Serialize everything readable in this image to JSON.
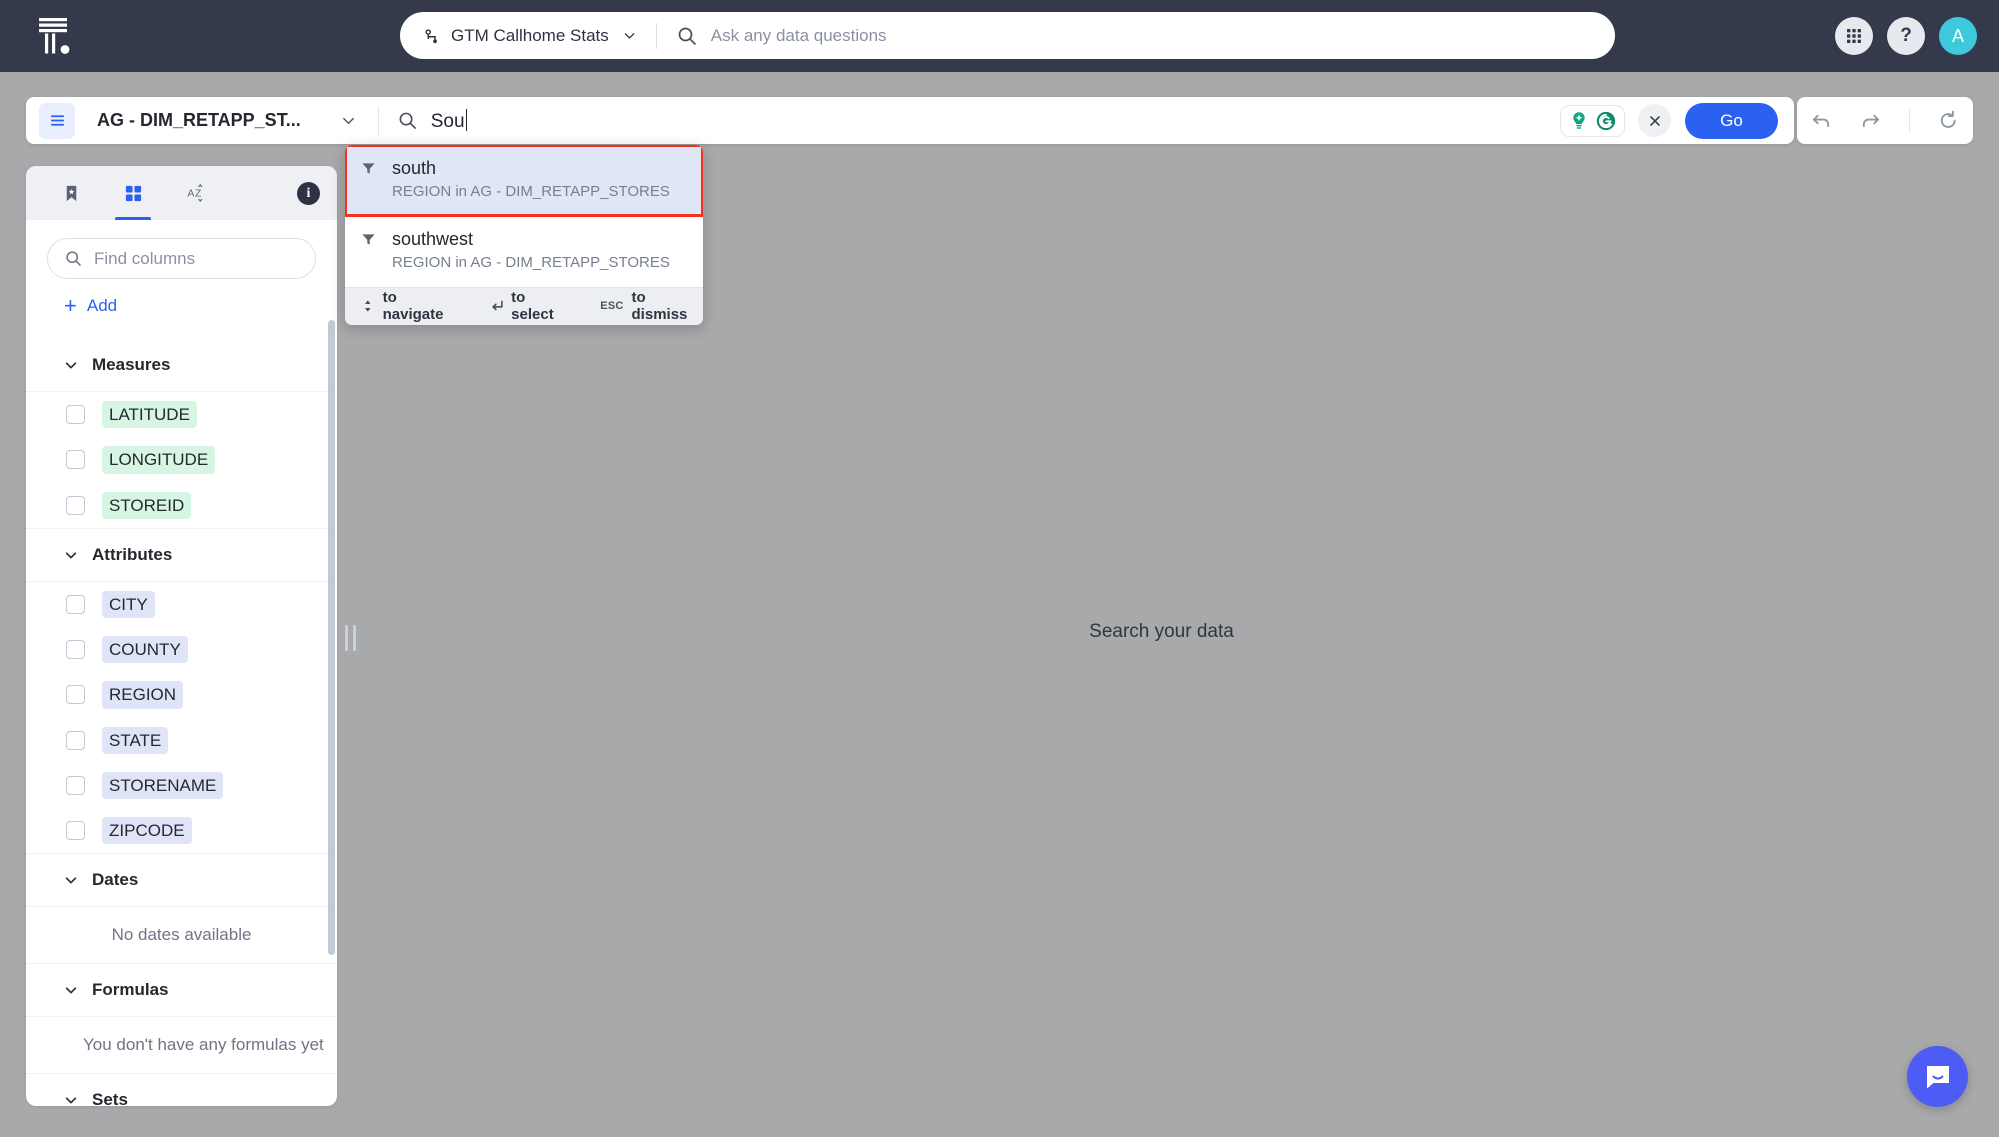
{
  "topnav": {
    "logo_name": "thoughtspot-logo",
    "datasource": {
      "icon": "datasource-icon",
      "label": "GTM Callhome Stats",
      "chevron": "chevron-down-icon"
    },
    "search": {
      "icon": "search-icon",
      "placeholder": "Ask any data questions",
      "value": ""
    },
    "apps_icon": "apps-grid-icon",
    "help_label": "?",
    "avatar_initial": "A"
  },
  "searchbar": {
    "menu_icon": "hamburger-menu-icon",
    "worksheet_name": "AG - DIM_RETAPP_ST...",
    "worksheet_chevron": "chevron-down-icon",
    "search_icon": "search-icon",
    "query_value": "Sou",
    "grammarly_assistant_icon": "grammarly-lightbulb-icon",
    "grammarly_icon": "grammarly-logo-icon",
    "clear_icon": "close-icon",
    "go_label": "Go"
  },
  "history": {
    "undo_icon": "undo-arrow-icon",
    "redo_icon": "redo-arrow-icon",
    "reset_icon": "reset-circular-arrow-icon"
  },
  "leftpanel": {
    "tabs": [
      {
        "id": "bookmarks",
        "icon": "bookmark-icon",
        "active": false
      },
      {
        "id": "columns",
        "icon": "grid-squares-icon",
        "active": true
      },
      {
        "id": "sort",
        "icon": "sort-az-icon",
        "active": false
      }
    ],
    "info_label": "i",
    "find": {
      "icon": "search-icon",
      "placeholder": "Find columns",
      "value": ""
    },
    "add_label": "Add",
    "add_icon": "plus-icon",
    "sections": [
      {
        "id": "measures",
        "title": "Measures",
        "chevron": "chevron-down-icon",
        "chip_style": "measure",
        "items": [
          "LATITUDE",
          "LONGITUDE",
          "STOREID"
        ],
        "empty": null
      },
      {
        "id": "attributes",
        "title": "Attributes",
        "chevron": "chevron-down-icon",
        "chip_style": "attr",
        "items": [
          "CITY",
          "COUNTY",
          "REGION",
          "STATE",
          "STORENAME",
          "ZIPCODE"
        ],
        "empty": null
      },
      {
        "id": "dates",
        "title": "Dates",
        "chevron": "chevron-down-icon",
        "chip_style": "attr",
        "items": [],
        "empty": "No dates available"
      },
      {
        "id": "formulas",
        "title": "Formulas",
        "chevron": "chevron-down-icon",
        "chip_style": "attr",
        "items": [],
        "empty": "You don't have any formulas yet"
      },
      {
        "id": "sets",
        "title": "Sets",
        "chevron": "chevron-down-icon",
        "chip_style": "attr",
        "items": [],
        "empty": null
      }
    ]
  },
  "suggestions": {
    "items": [
      {
        "icon": "filter-icon",
        "title": "south",
        "subtitle": "REGION in AG - DIM_RETAPP_STORES",
        "selected": true
      },
      {
        "icon": "filter-icon",
        "title": "southwest",
        "subtitle": "REGION in AG - DIM_RETAPP_STORES",
        "selected": false
      }
    ],
    "hints": [
      {
        "key_icon": "up-down-arrow-icon",
        "key_text": "",
        "label": "to navigate"
      },
      {
        "key_icon": "enter-arrow-icon",
        "key_text": "",
        "label": "to select"
      },
      {
        "key_icon": "",
        "key_text": "ESC",
        "label": "to dismiss"
      }
    ]
  },
  "canvas": {
    "message": "Search your data",
    "drag_handle": "panel-resize-handle"
  },
  "chat": {
    "icon": "intercom-chat-icon"
  },
  "colors": {
    "nav_bg": "#343a4b",
    "page_bg": "#a8a9ab",
    "accent_blue": "#2b61f0",
    "avatar": "#3fc9dd",
    "measure_chip": "#d6f5e3",
    "attribute_chip": "#dfe4f7",
    "highlight_outline": "#f4331f",
    "selection_bg": "#dfe7f6",
    "chat_bubble": "#4c5cf5"
  }
}
